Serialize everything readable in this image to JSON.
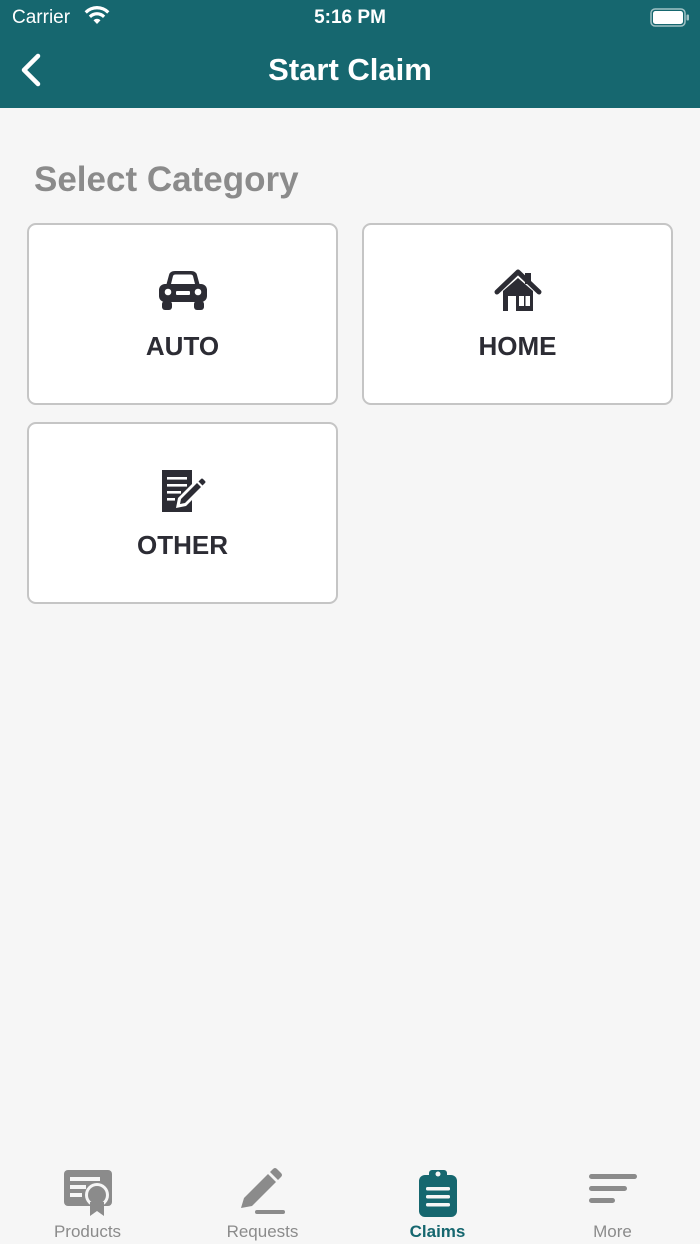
{
  "status_bar": {
    "carrier": "Carrier",
    "time": "5:16 PM"
  },
  "header": {
    "title": "Start Claim"
  },
  "main": {
    "section_title": "Select Category",
    "categories": [
      {
        "label": "AUTO",
        "icon": "car-icon"
      },
      {
        "label": "HOME",
        "icon": "house-icon"
      },
      {
        "label": "OTHER",
        "icon": "note-pencil-icon"
      }
    ]
  },
  "tabbar": {
    "items": [
      {
        "label": "Products",
        "icon": "certificate-icon"
      },
      {
        "label": "Requests",
        "icon": "pencil-icon"
      },
      {
        "label": "Claims",
        "icon": "clipboard-icon",
        "active": true
      },
      {
        "label": "More",
        "icon": "menu-lines-icon"
      }
    ]
  },
  "colors": {
    "accent": "#16676f",
    "inactive": "#8b8b8b",
    "background": "#f6f6f6"
  }
}
